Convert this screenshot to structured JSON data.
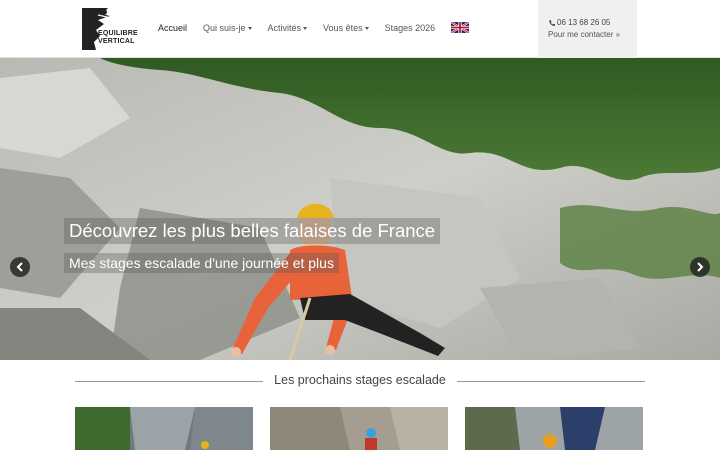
{
  "brand": {
    "name_line1": "EQUILIBRE",
    "name_line2": "VERTICAL"
  },
  "nav": {
    "items": [
      {
        "label": "Accueil",
        "active": true,
        "dropdown": false
      },
      {
        "label": "Qui suis-je",
        "active": false,
        "dropdown": true
      },
      {
        "label": "Activités",
        "active": false,
        "dropdown": true
      },
      {
        "label": "Vous êtes",
        "active": false,
        "dropdown": true
      },
      {
        "label": "Stages 2026",
        "active": false,
        "dropdown": false
      }
    ],
    "language_icon": "uk-flag-icon"
  },
  "contact": {
    "phone": "06 13 68 26 05",
    "link": "Pour me contacter »",
    "phone_icon": "phone-icon"
  },
  "hero": {
    "title": "Découvrez les plus belles falaises de France",
    "subtitle": "Mes stages escalade d'une journée et plus",
    "prev_icon": "chevron-left-icon",
    "next_icon": "chevron-right-icon"
  },
  "section": {
    "title": "Les prochains stages escalade"
  },
  "colors": {
    "accent": "#f0f0f0",
    "text": "#444444",
    "rule": "#999999"
  }
}
